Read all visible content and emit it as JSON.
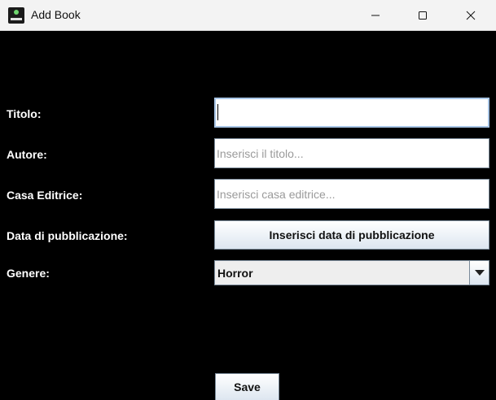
{
  "window": {
    "title": "Add Book",
    "app_icon": "book-app-icon",
    "controls": {
      "minimize_icon": "minimize-icon",
      "maximize_icon": "maximize-icon",
      "close_icon": "close-icon"
    }
  },
  "form": {
    "titolo": {
      "label": "Titolo:",
      "value": "",
      "placeholder": ""
    },
    "autore": {
      "label": "Autore:",
      "value": "",
      "placeholder": "Inserisci il titolo..."
    },
    "casa_editrice": {
      "label": "Casa Editrice:",
      "value": "",
      "placeholder": "Inserisci casa editrice..."
    },
    "data_pubblicazione": {
      "label": "Data di pubblicazione:",
      "button_label": "Inserisci data di pubblicazione"
    },
    "genere": {
      "label": "Genere:",
      "selected": "Horror",
      "arrow_icon": "chevron-down-icon"
    }
  },
  "actions": {
    "save_label": "Save"
  },
  "colors": {
    "background": "#000000",
    "titlebar": "#f3f3f3",
    "label_text": "#ffffff",
    "focus_border": "#a9c6e6"
  }
}
